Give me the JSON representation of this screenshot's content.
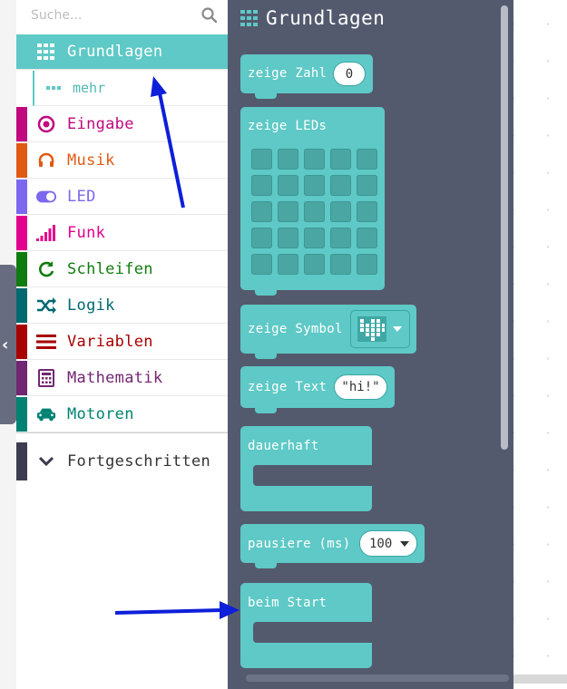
{
  "search": {
    "placeholder": "Suche...",
    "icon": "search-icon"
  },
  "categories": [
    {
      "label": "Grundlagen",
      "color": "#5ec9c6",
      "text_color": "#ffffff",
      "icon": "grid-icon",
      "selected": true
    },
    {
      "label": "Eingabe",
      "color": "#c0087f",
      "text_color": "#c0087f",
      "icon": "target-icon"
    },
    {
      "label": "Musik",
      "color": "#e05a12",
      "text_color": "#e05a12",
      "icon": "headphones-icon"
    },
    {
      "label": "LED",
      "color": "#7b68ee",
      "text_color": "#7b68ee",
      "icon": "toggle-icon"
    },
    {
      "label": "Funk",
      "color": "#e3008c",
      "text_color": "#e3008c",
      "icon": "signal-bars-icon"
    },
    {
      "label": "Schleifen",
      "color": "#107c10",
      "text_color": "#107c10",
      "icon": "refresh-icon"
    },
    {
      "label": "Logik",
      "color": "#006970",
      "text_color": "#006970",
      "icon": "shuffle-icon"
    },
    {
      "label": "Variablen",
      "color": "#a80000",
      "text_color": "#a80000",
      "icon": "list-icon"
    },
    {
      "label": "Mathematik",
      "color": "#712672",
      "text_color": "#712672",
      "icon": "calculator-icon"
    },
    {
      "label": "Motoren",
      "color": "#008272",
      "text_color": "#008272",
      "icon": "car-icon"
    }
  ],
  "sub_category": {
    "label": "mehr",
    "icon": "dots-icon"
  },
  "advanced": {
    "label": "Fortgeschritten",
    "color": "#3c3c50",
    "icon": "chevron-down-icon"
  },
  "flyout": {
    "title": "Grundlagen",
    "title_icon": "grid-icon",
    "blocks": {
      "show_number": {
        "label": "zeige Zahl",
        "value": "0"
      },
      "show_leds": {
        "label": "zeige LEDs"
      },
      "show_icon": {
        "label": "zeige Symbol",
        "icon": "heart-icon"
      },
      "show_string": {
        "label": "zeige Text",
        "value": "\"hi!\""
      },
      "forever": {
        "label": "dauerhaft"
      },
      "pause": {
        "label": "pausiere (ms)",
        "value": "100"
      },
      "on_start": {
        "label": "beim Start"
      }
    }
  },
  "annotations": {
    "arrow_color": "#0d1fd8"
  }
}
